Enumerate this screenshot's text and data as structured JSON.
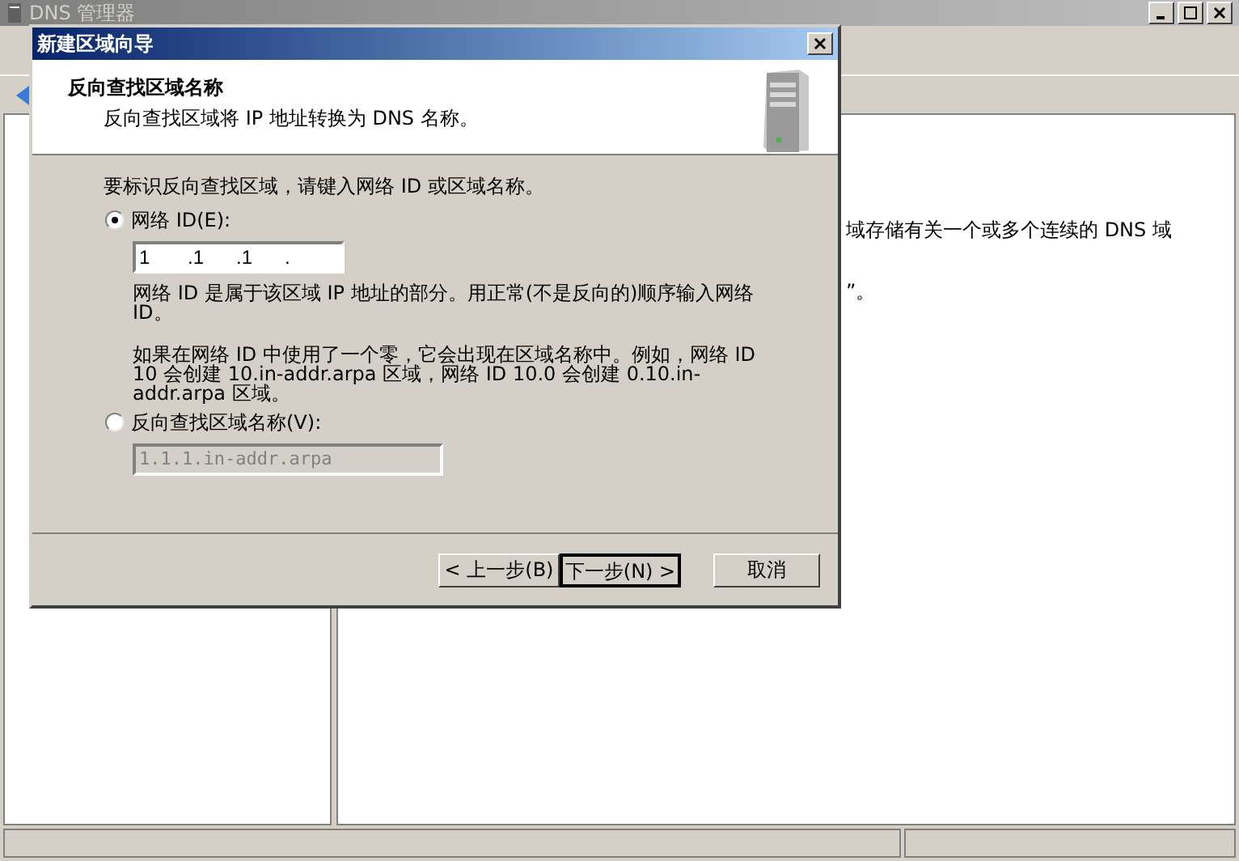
{
  "main_window": {
    "title": "DNS 管理器",
    "content_lines": [
      "域存储有关一个或多个连续的 DNS 域",
      "”。"
    ]
  },
  "dialog": {
    "title": "新建区域向导",
    "heading": "反向查找区域名称",
    "subtitle": "反向查找区域将 IP 地址转换为 DNS 名称。",
    "intro": "要标识反向查找区域，请键入网络 ID 或区域名称。",
    "options": [
      {
        "label": "网络 ID(E):",
        "selected": true,
        "kind": "octets",
        "octets": [
          "1",
          ".1",
          ".1",
          "."
        ],
        "help": [
          "网络 ID 是属于该区域 IP 地址的部分。用正常(不是反向的)顺序输入网络 ID。",
          "如果在网络 ID 中使用了一个零，它会出现在区域名称中。例如，网络 ID 10 会创建 10.in-addr.arpa 区域，网络 ID 10.0 会创建 0.10.in-addr.arpa 区域。"
        ]
      },
      {
        "label": "反向查找区域名称(V):",
        "selected": false,
        "kind": "text",
        "value": "1.1.1.in-addr.arpa",
        "disabled": true
      }
    ],
    "buttons": [
      {
        "label": "< 上一步(B)",
        "default": false
      },
      {
        "label": "下一步(N) >",
        "default": true
      },
      {
        "label": "取消",
        "default": false
      }
    ]
  }
}
